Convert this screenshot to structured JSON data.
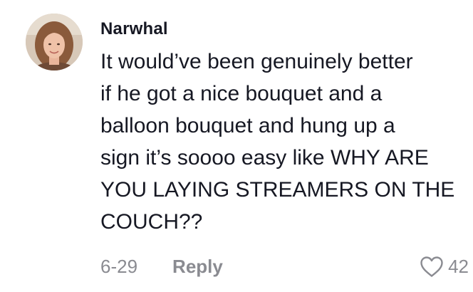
{
  "comment": {
    "username": "Narwhal",
    "lines": [
      "It would’ve been genuinely better",
      "if he got a nice bouquet and a",
      "balloon bouquet and hung up a",
      "sign it’s soooo easy like WHY ARE",
      "YOU LAYING STREAMERS ON THE",
      "COUCH??"
    ],
    "date": "6-29",
    "reply_label": "Reply",
    "like_count": "42",
    "like_icon": "heart-outline-icon",
    "avatar": "profile-photo"
  },
  "colors": {
    "text": "#161823",
    "secondary": "#8a8b91",
    "background": "#ffffff"
  }
}
